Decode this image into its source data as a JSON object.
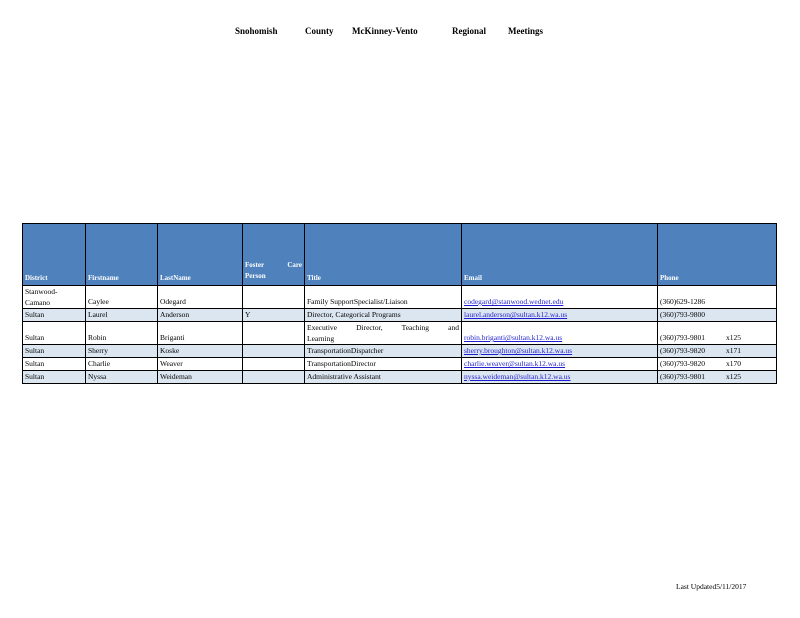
{
  "title_words": [
    "Snohomish",
    "County",
    "McKinney-Vento",
    "Regional",
    "Meetings"
  ],
  "headers": {
    "district": "District",
    "firstname": "Firstname",
    "lastname": "LastName",
    "foster_line1": "Foster Care",
    "foster_line2": "Person",
    "title": "Title",
    "email": "Email",
    "phone": "Phone"
  },
  "rows": [
    {
      "district_1": "Stanwood-",
      "district_2": "Camano",
      "firstname": "Caylee",
      "lastname": "Odegard",
      "foster": "",
      "title_1": "",
      "title_2": "Family SupportSpecialist/Liaison",
      "email": "codegard@stanwood.wednet.edu",
      "phone": "(360)629-1286",
      "ext": ""
    },
    {
      "district": "Sultan",
      "firstname": "Laurel",
      "lastname": "Anderson",
      "foster": "Y",
      "title": "Director, Categorical Programs",
      "email": "laurel.anderson@sultan.k12.wa.us",
      "phone": "(360)793-9800",
      "ext": ""
    },
    {
      "district": "Sultan",
      "firstname": "Robin",
      "lastname": "Briganti",
      "foster": "",
      "title_1": "Executive Director, Teaching and",
      "title_2": "Learning",
      "email": "robin.briganti@sultan.k12.wa.us",
      "phone": "(360)793-9801",
      "ext": "x125"
    },
    {
      "district": "Sultan",
      "firstname": "Sherry",
      "lastname": "Koske",
      "foster": "",
      "title": "TransportationDispatcher",
      "email": "sherry.broughton@sultan.k12.wa.us",
      "phone": "(360)793-9820",
      "ext": "x171"
    },
    {
      "district": "Sultan",
      "firstname": "Charlie",
      "lastname": "Weaver",
      "foster": "",
      "title": "TransportationDirector",
      "email": "charlie.weaver@sultan.k12.wa.us",
      "phone": "(360)793-9820",
      "ext": "x170"
    },
    {
      "district": "Sultan",
      "firstname": "Nyssa",
      "lastname": "Weideman",
      "foster": "",
      "title": "Administrative Assistant",
      "email": "nyssa.weideman@sultan.k12.wa.us",
      "phone": "(360)793-9801",
      "ext": "x125"
    }
  ],
  "footer": "Last Updated5/11/2017"
}
